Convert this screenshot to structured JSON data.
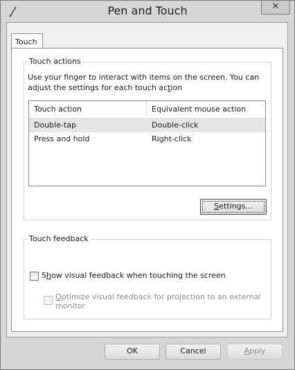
{
  "window": {
    "title": "Pen and Touch",
    "icon": "pen-icon",
    "close_glyph": "✕"
  },
  "tabs": [
    {
      "label": "Touch",
      "selected": true
    }
  ],
  "touch_actions": {
    "group_label": "Touch actions",
    "desc_line1": "Use your finger to interact with items on the screen. You can",
    "desc_line2_pre": "adjust the settings for each touch ac",
    "desc_line2_ul": "t",
    "desc_line2_post": "ion",
    "columns": [
      "Touch action",
      "Equivalent mouse action"
    ],
    "rows": [
      {
        "action": "Double-tap",
        "mouse": "Double-click",
        "selected": true
      },
      {
        "action": "Press and hold",
        "mouse": "Right-click",
        "selected": false
      }
    ],
    "settings_ul": "S",
    "settings_rest": "ettings..."
  },
  "touch_feedback": {
    "group_label": "Touch feedback",
    "show_pre": "S",
    "show_ul": "h",
    "show_post": "ow visual feedback when touching the screen",
    "show_checked": false,
    "optimize_ul": "O",
    "optimize_line1": "ptimize visual feedback for projection to an external",
    "optimize_line2": "monitor",
    "optimize_checked": false,
    "optimize_enabled": false
  },
  "footer": {
    "ok": "OK",
    "cancel": "Cancel",
    "apply_ul": "A",
    "apply_rest": "pply",
    "apply_enabled": false
  }
}
